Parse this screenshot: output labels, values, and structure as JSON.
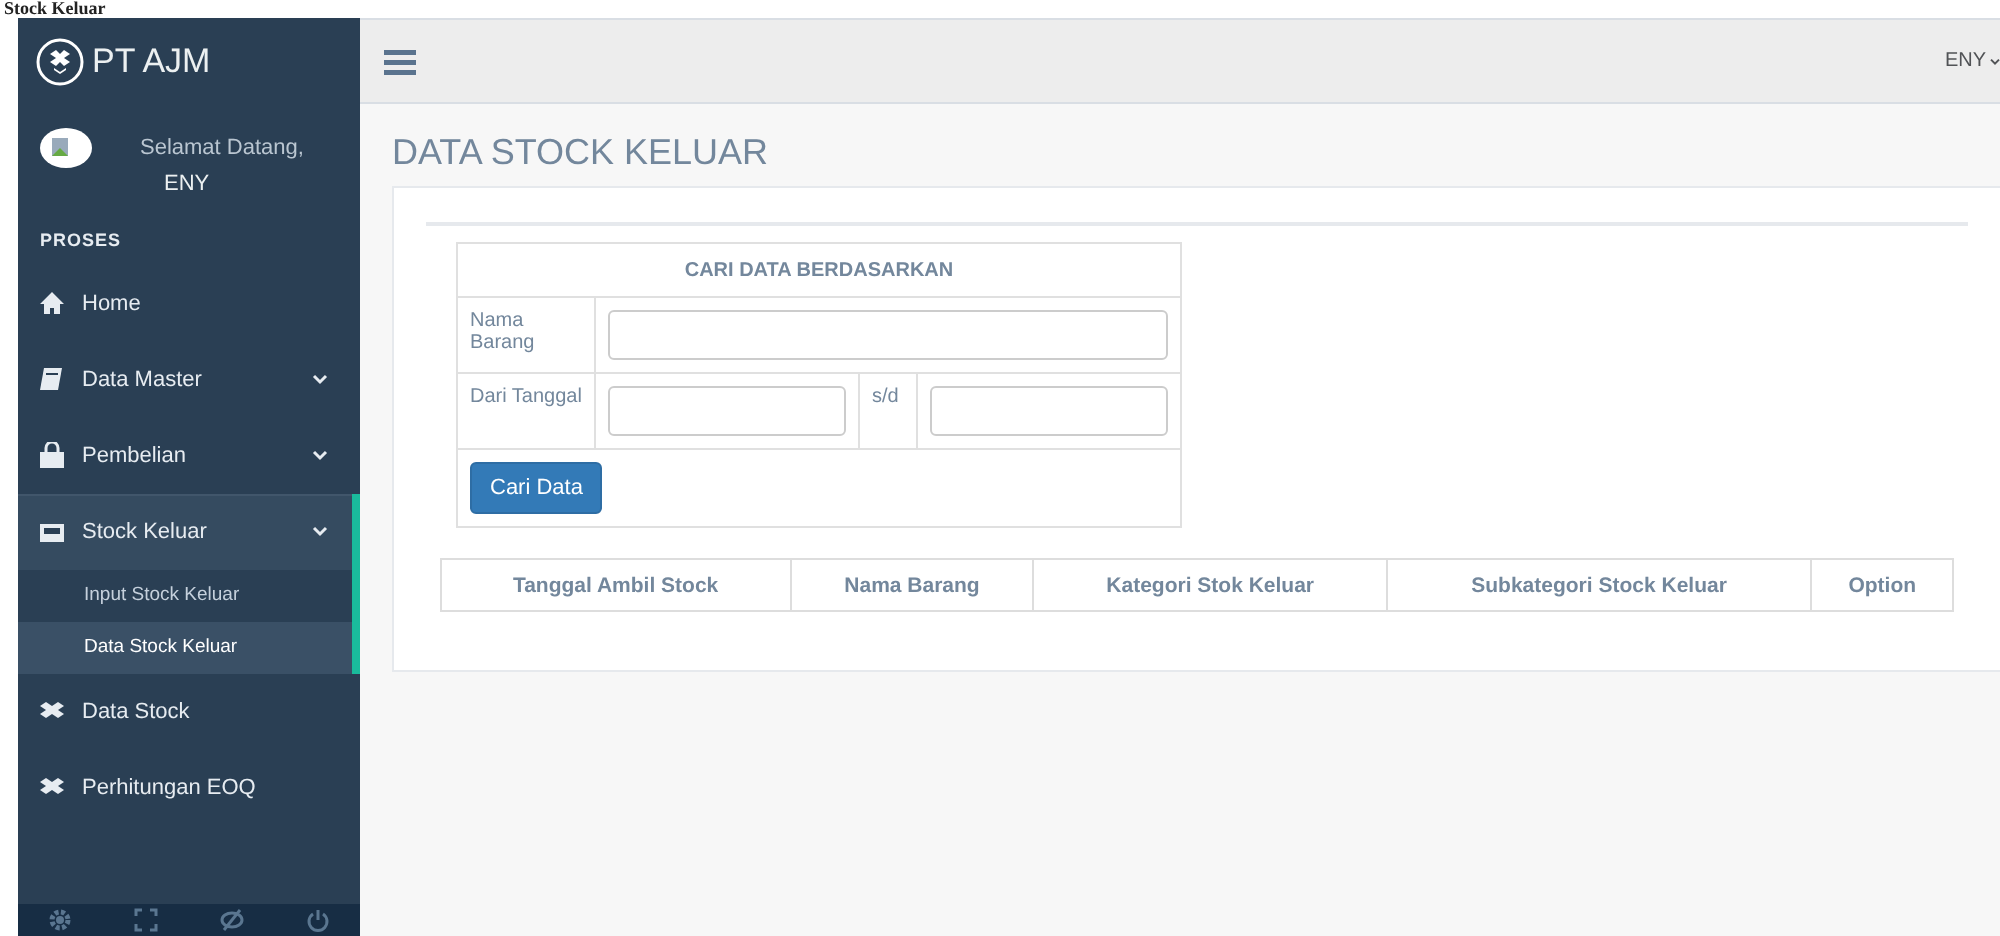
{
  "page_heading": "Stock Keluar",
  "sidebar": {
    "brand": "PT AJM",
    "user": {
      "greeting": "Selamat Datang,",
      "name": "ENY"
    },
    "section": "PROSES",
    "menu": [
      {
        "label": "Home",
        "kind": "link",
        "selected": false
      },
      {
        "label": "Data Master",
        "kind": "dropdown",
        "selected": false
      },
      {
        "label": "Pembelian",
        "kind": "dropdown",
        "selected": false
      },
      {
        "label": "Stock Keluar",
        "kind": "dropdown",
        "expanded": true,
        "selected": true,
        "children": [
          {
            "label": "Input Stock Keluar",
            "selected": false
          },
          {
            "label": "Data Stock Keluar",
            "selected": true
          }
        ]
      },
      {
        "label": "Data Stock",
        "kind": "link",
        "selected": false
      },
      {
        "label": "Perhitungan EOQ",
        "kind": "link",
        "selected": false
      }
    ]
  },
  "topbar": {
    "user": "ENY"
  },
  "title": "DATA STOCK KELUAR",
  "search": {
    "heading": "CARI DATA BERDASARKAN",
    "name_label": "Nama Barang",
    "date_label": "Dari Tanggal",
    "until_label": "s/d",
    "button": "Cari Data"
  },
  "table": {
    "columns": [
      "Tanggal Ambil Stock",
      "Nama Barang",
      "Kategori Stok Keluar",
      "Subkategori Stock Keluar",
      "Option"
    ]
  }
}
